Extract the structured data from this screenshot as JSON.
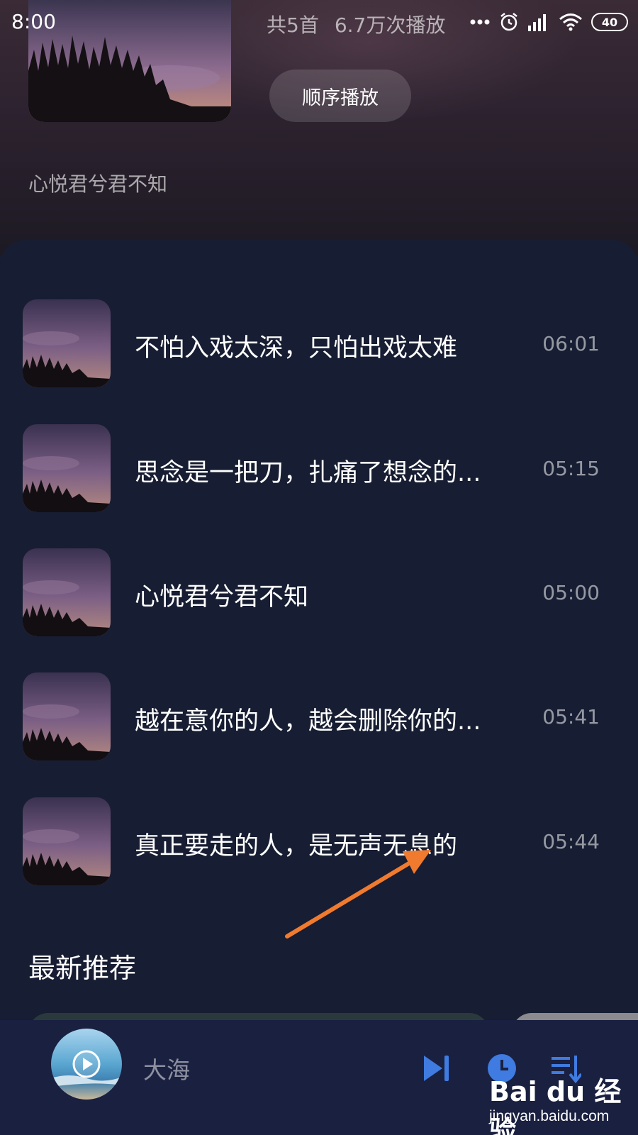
{
  "status_bar": {
    "time": "8:00",
    "battery": "40",
    "icons": [
      "more-dots-icon",
      "alarm-icon",
      "signal-icon",
      "wifi-icon",
      "battery-icon"
    ]
  },
  "playlist": {
    "song_count": "共5首",
    "play_count": "6.7万次播放",
    "play_order_label": "顺序播放",
    "description": "心悦君兮君不知"
  },
  "songs": [
    {
      "title": "不怕入戏太深，只怕出戏太难",
      "duration": "06:01"
    },
    {
      "title": "思念是一把刀，扎痛了想念的...",
      "duration": "05:15"
    },
    {
      "title": "心悦君兮君不知",
      "duration": "05:00"
    },
    {
      "title": "越在意你的人，越会删除你的...",
      "duration": "05:41"
    },
    {
      "title": "真正要走的人，是无声无息的",
      "duration": "05:44"
    }
  ],
  "recommend": {
    "section_title": "最新推荐"
  },
  "mini_player": {
    "title": "大海",
    "icons": [
      "play-icon",
      "skip-next-icon",
      "timer-icon",
      "playlist-icon"
    ]
  },
  "watermark": {
    "logo": "Bai du 经验",
    "url": "jingyan.baidu.com"
  },
  "colors": {
    "list_background": "#171d32",
    "player_background": "#1a2040",
    "annotation_arrow": "#f07a2e",
    "player_icons": "#3f7be0"
  }
}
